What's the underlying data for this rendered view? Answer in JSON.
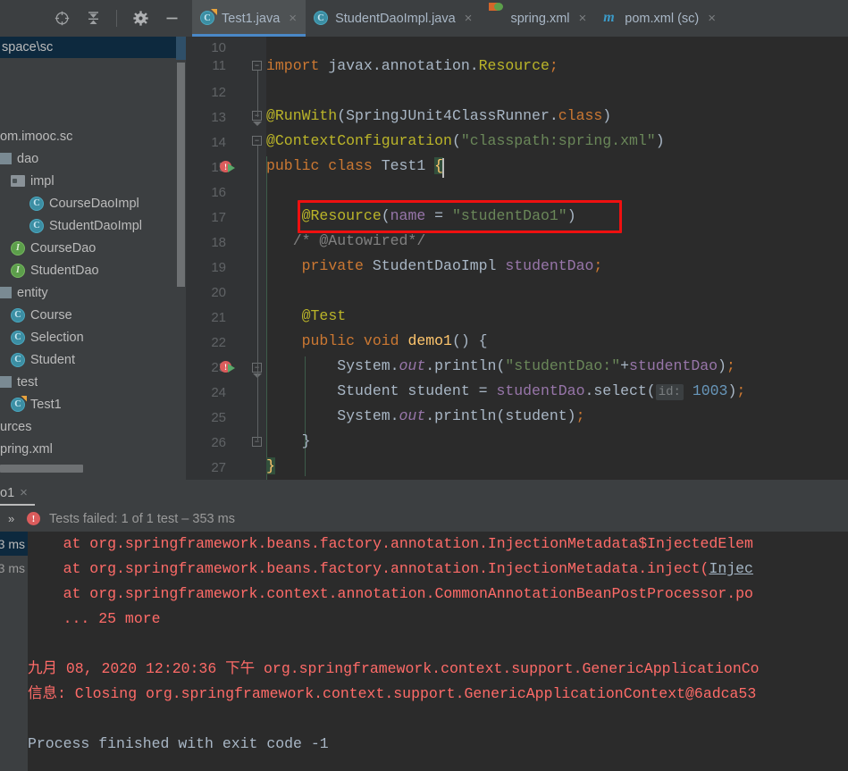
{
  "toolbar": {
    "icons": [
      {
        "name": "locate-target-icon",
        "glyph": "⊕"
      },
      {
        "name": "collapse-all-icon",
        "glyph": "⤓"
      },
      {
        "name": "settings-gear-icon",
        "glyph": "⚙"
      },
      {
        "name": "minimize-icon",
        "glyph": "—"
      }
    ]
  },
  "tabs": [
    {
      "label": "Test1.java",
      "icon": "class-runnable-icon",
      "icon_letter": "C",
      "active": true,
      "close": "×"
    },
    {
      "label": "StudentDaoImpl.java",
      "icon": "class-icon",
      "icon_letter": "C",
      "active": false,
      "close": "×"
    },
    {
      "label": "spring.xml",
      "icon": "xml-spring-icon",
      "icon_letter": "",
      "active": false,
      "close": "×"
    },
    {
      "label": "pom.xml (sc)",
      "icon": "maven-icon",
      "icon_letter": "m",
      "active": false,
      "close": "×"
    }
  ],
  "sidebar": {
    "path": "space\\sc",
    "items": [
      {
        "label": "",
        "icon": "none",
        "indent": 0,
        "blank": true
      },
      {
        "label": "",
        "icon": "none",
        "indent": 0,
        "blank": true
      },
      {
        "label": "",
        "icon": "none",
        "indent": 0,
        "blank": true
      },
      {
        "label": "om.imooc.sc",
        "icon": "none",
        "indent": 0
      },
      {
        "label": "dao",
        "icon": "package-icon",
        "indent": 0
      },
      {
        "label": "impl",
        "icon": "folder-icon",
        "indent": 1
      },
      {
        "label": "CourseDaoImpl",
        "icon": "class-icon",
        "indent": 2
      },
      {
        "label": "StudentDaoImpl",
        "icon": "class-icon",
        "indent": 2
      },
      {
        "label": "CourseDao",
        "icon": "interface-icon",
        "indent": 1
      },
      {
        "label": "StudentDao",
        "icon": "interface-icon",
        "indent": 1
      },
      {
        "label": "entity",
        "icon": "package-icon",
        "indent": 0
      },
      {
        "label": "Course",
        "icon": "class-icon",
        "indent": 1
      },
      {
        "label": "Selection",
        "icon": "class-icon",
        "indent": 1
      },
      {
        "label": "Student",
        "icon": "class-icon",
        "indent": 1
      },
      {
        "label": "test",
        "icon": "package-icon",
        "indent": 0
      },
      {
        "label": "Test1",
        "icon": "class-runnable-icon",
        "indent": 1
      },
      {
        "label": "urces",
        "icon": "none",
        "indent": 0
      },
      {
        "label": "pring.xml",
        "icon": "none",
        "indent": 0
      }
    ]
  },
  "editor": {
    "first_line": 10,
    "lines": [
      {
        "n": 10,
        "text": "",
        "cut": true
      },
      {
        "n": 11,
        "text": "import javax.annotation.Resource;"
      },
      {
        "n": 12,
        "text": ""
      },
      {
        "n": 13,
        "text": "@RunWith(SpringJUnit4ClassRunner.class)"
      },
      {
        "n": 14,
        "text": "@ContextConfiguration(\"classpath:spring.xml\")"
      },
      {
        "n": 15,
        "text": "public class Test1 {",
        "marker": "run-breakpoint"
      },
      {
        "n": 16,
        "text": ""
      },
      {
        "n": 17,
        "text": "    @Resource(name = \"studentDao1\")",
        "highlighted": true
      },
      {
        "n": 18,
        "text": "    /* @Autowired*/"
      },
      {
        "n": 19,
        "text": "    private StudentDaoImpl studentDao;"
      },
      {
        "n": 20,
        "text": ""
      },
      {
        "n": 21,
        "text": "    @Test"
      },
      {
        "n": 22,
        "text": "    public void demo1() {",
        "marker": "run-breakpoint"
      },
      {
        "n": 23,
        "text": "        System.out.println(\"studentDao:\"+studentDao);"
      },
      {
        "n": 24,
        "text": "        Student student = studentDao.select( id: 1003);",
        "hint": "id:"
      },
      {
        "n": 25,
        "text": "        System.out.println(student);"
      },
      {
        "n": 26,
        "text": "    }"
      },
      {
        "n": 27,
        "text": "}"
      }
    ]
  },
  "run_panel": {
    "tab_label": "o1",
    "tab_close": "×",
    "expand_chevron": "»",
    "status": "Tests failed: 1 of 1 test – 353 ms",
    "test_times": [
      "3 ms",
      "3 ms"
    ],
    "console": [
      {
        "text": "    at org.springframework.beans.factory.annotation.InjectionMetadata$InjectedElem",
        "color": "red"
      },
      {
        "text": "    at org.springframework.beans.factory.annotation.InjectionMetadata.inject(Injec",
        "color": "red",
        "link_from": 73
      },
      {
        "text": "    at org.springframework.context.annotation.CommonAnnotationBeanPostProcessor.po",
        "color": "red"
      },
      {
        "text": "    ... 25 more",
        "color": "red"
      },
      {
        "text": "",
        "color": "red"
      },
      {
        "text": "九月 08, 2020 12:20:36 下午 org.springframework.context.support.GenericApplicationCo",
        "color": "red"
      },
      {
        "text": "信息: Closing org.springframework.context.support.GenericApplicationContext@6adca53",
        "color": "red"
      },
      {
        "text": "",
        "color": "red"
      },
      {
        "text": "Process finished with exit code -1",
        "color": "grey"
      }
    ]
  },
  "colors": {
    "accent_blue": "#4a88c7",
    "error_red": "#ff6b68",
    "highlight_box": "#ef1010",
    "keyword": "#cc7832",
    "annotation": "#bbb529",
    "string": "#6a8759",
    "number": "#6897bb",
    "field": "#9876aa",
    "comment": "#808080",
    "editor_bg": "#2b2b2b",
    "ui_bg": "#3c3f41"
  }
}
